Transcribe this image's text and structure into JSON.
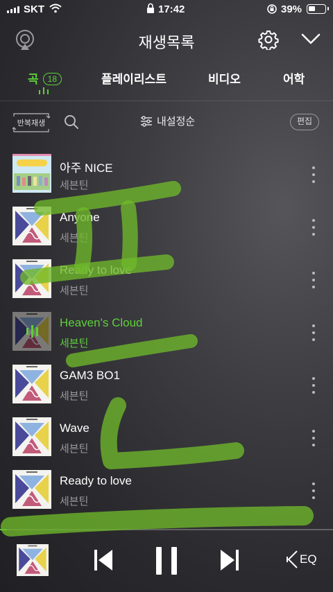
{
  "status": {
    "carrier": "SKT",
    "time": "17:42",
    "battery": "39%",
    "battery_level": 0.39
  },
  "header": {
    "title": "재생목록"
  },
  "tabs": [
    {
      "label": "곡",
      "count": "18",
      "active": true
    },
    {
      "label": "플레이리스트"
    },
    {
      "label": "비디오"
    },
    {
      "label": "어학"
    }
  ],
  "toolbar": {
    "repeat_label": "반복재생",
    "sort_label": "내설정순",
    "edit_label": "편집"
  },
  "songs": [
    {
      "title": "아주 NICE",
      "artist": "세븐틴",
      "art": "nice"
    },
    {
      "title": "Anyone",
      "artist": "세븐틴",
      "art": "heng"
    },
    {
      "title": "Ready to love",
      "artist": "세븐틴",
      "art": "heng"
    },
    {
      "title": "Heaven's Cloud",
      "artist": "세븐틴",
      "art": "heng",
      "current": true
    },
    {
      "title": "GAM3 BO1",
      "artist": "세븐틴",
      "art": "heng"
    },
    {
      "title": "Wave",
      "artist": "세븐틴",
      "art": "heng"
    },
    {
      "title": "Ready to love",
      "artist": "세븐틴",
      "art": "heng"
    }
  ],
  "player": {
    "progress": 0.02,
    "eq_label": "EQ"
  },
  "colors": {
    "accent": "#5fd039",
    "background": "#2e2e32",
    "scribble": "#6fb82a"
  },
  "icons": [
    "cellular-signal-icon",
    "wifi-icon",
    "lock-icon",
    "rotation-lock-icon",
    "battery-icon",
    "airplay-icon",
    "gear-icon",
    "chevron-down-icon",
    "repeat-icon",
    "search-icon",
    "sort-sliders-icon",
    "more-vertical-icon",
    "previous-track-icon",
    "pause-icon",
    "next-track-icon",
    "equalizer-icon"
  ]
}
